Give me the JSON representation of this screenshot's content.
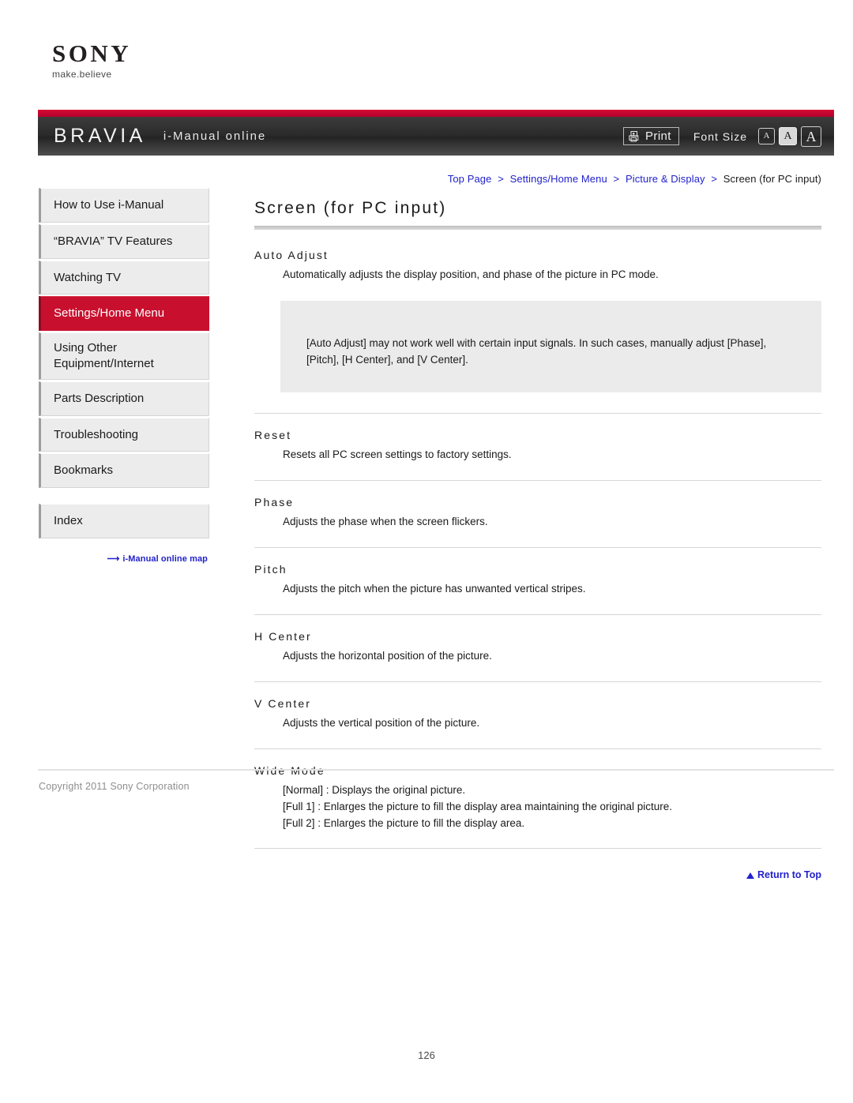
{
  "brand": {
    "wordmark": "SONY",
    "tagline": "make.believe"
  },
  "header": {
    "logo": "BRAVIA",
    "subtitle": "i-Manual online",
    "print_label": "Print",
    "font_size_label": "Font Size",
    "font_sizes": [
      {
        "label": "A",
        "size": "small",
        "selected": false
      },
      {
        "label": "A",
        "size": "medium",
        "selected": true
      },
      {
        "label": "A",
        "size": "large",
        "selected": false
      }
    ]
  },
  "breadcrumb": {
    "items": [
      {
        "label": "Top Page",
        "is_link": true
      },
      {
        "label": "Settings/Home Menu",
        "is_link": true
      },
      {
        "label": "Picture & Display",
        "is_link": true
      },
      {
        "label": "Screen (for PC input)",
        "is_link": false
      }
    ],
    "separator": ">"
  },
  "sidebar": {
    "items": [
      {
        "label": "How to Use i-Manual",
        "active": false
      },
      {
        "label": "“BRAVIA” TV Features",
        "active": false
      },
      {
        "label": "Watching TV",
        "active": false
      },
      {
        "label": "Settings/Home Menu",
        "active": true
      },
      {
        "label": "Using Other Equipment/Internet",
        "active": false
      },
      {
        "label": "Parts Description",
        "active": false
      },
      {
        "label": "Troubleshooting",
        "active": false
      },
      {
        "label": "Bookmarks",
        "active": false
      }
    ],
    "index_label": "Index",
    "map_link_label": "i-Manual online map",
    "map_link_arrow": "⟶"
  },
  "main": {
    "title": "Screen (for PC input)",
    "sections": [
      {
        "heading": "Auto Adjust",
        "body": "Automatically adjusts the display position, and phase of the picture in PC mode."
      },
      {
        "heading": "Reset",
        "body": "Resets all PC screen settings to factory settings."
      },
      {
        "heading": "Phase",
        "body": "Adjusts the phase when the screen flickers."
      },
      {
        "heading": "Pitch",
        "body": "Adjusts the pitch when the picture has unwanted vertical stripes."
      },
      {
        "heading": "H Center",
        "body": "Adjusts the horizontal position of the picture."
      },
      {
        "heading": "V Center",
        "body": "Adjusts the vertical position of the picture."
      },
      {
        "heading": "Wide Mode",
        "body": "[Normal] : Displays the original picture.\n[Full 1] : Enlarges the picture to fill the display area maintaining the original picture.\n[Full 2] : Enlarges the picture to fill the display area."
      }
    ],
    "note": "[Auto Adjust] may not work well with certain input signals. In such cases, manually adjust [Phase], [Pitch], [H Center], and [V Center].",
    "return_to_top": "Return to Top"
  },
  "footer": {
    "copyright": "Copyright 2011 Sony Corporation",
    "page_number": "126"
  },
  "colors": {
    "accent_red": "#c8102e",
    "header_red_strip": "#cc0033",
    "link_blue": "#2222cc",
    "note_bg": "#ebebeb",
    "sidebar_bg": "#ececec"
  }
}
